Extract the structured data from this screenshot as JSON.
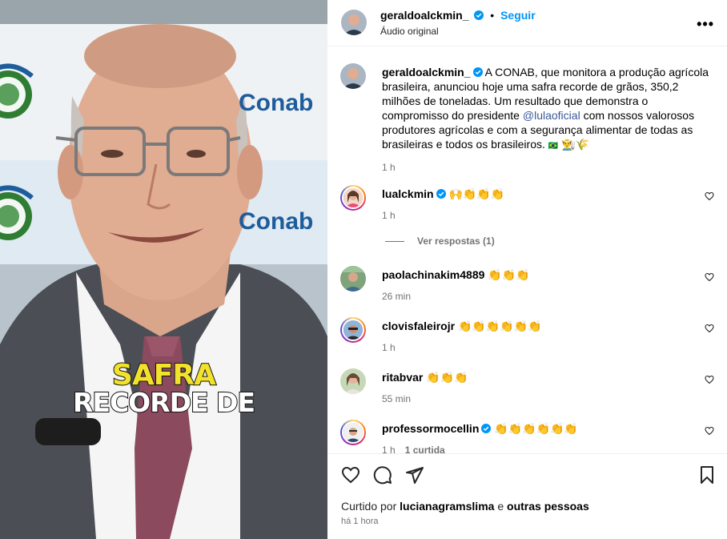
{
  "media": {
    "caption_line1": "SAFRA",
    "caption_line2": "RECORDE DE",
    "banner_brand": "Conab"
  },
  "header": {
    "username": "geraldoalckmin_",
    "separator": "•",
    "follow_label": "Seguir",
    "audio_label": "Áudio original",
    "more_icon": "more-horizontal-icon"
  },
  "post": {
    "username": "geraldoalckmin_",
    "text_before_mention": "A CONAB, que monitora a produção agrícola brasileira, anunciou hoje uma safra recorde de grãos, 350,2 milhões de toneladas. Um resultado que demonstra o compromisso do presidente ",
    "mention": "@lulaoficial",
    "text_after_mention": " com nossos valorosos produtores agrícolas e com a segurança alimentar de todas as brasileiras e todos os brasileiros.",
    "flag": "🇧🇷",
    "emojis": "👨‍🌾🌾",
    "time": "1 h"
  },
  "comments": [
    {
      "username": "lualckmin",
      "verified": true,
      "text": "🙌👏👏👏",
      "time": "1 h",
      "extra": "",
      "replies_label": "Ver respostas (1)"
    },
    {
      "username": "paolachinakim4889",
      "verified": false,
      "text": "👏👏👏",
      "time": "26 min",
      "extra": ""
    },
    {
      "username": "clovisfaleirojr",
      "verified": false,
      "text": "👏👏👏👏👏👏",
      "time": "1 h",
      "extra": ""
    },
    {
      "username": "ritabvar",
      "verified": false,
      "text": "👏👏👏",
      "time": "55 min",
      "extra": ""
    },
    {
      "username": "professormocellin",
      "verified": true,
      "text": "👏👏👏👏👏👏",
      "time": "1 h",
      "extra": "1 curtida"
    }
  ],
  "actions": {
    "like_icon": "heart-icon",
    "comment_icon": "comment-icon",
    "share_icon": "send-icon",
    "save_icon": "bookmark-icon",
    "liked_prefix": "Curtido por",
    "liked_user": "lucianagramslima",
    "liked_conj": "e",
    "liked_others": "outras pessoas",
    "timestamp": "há 1 hora"
  },
  "colors": {
    "link": "#0095f6",
    "verified": "#0095f6",
    "secondary_text": "#737373",
    "caption_yellow": "#f2e22b"
  }
}
